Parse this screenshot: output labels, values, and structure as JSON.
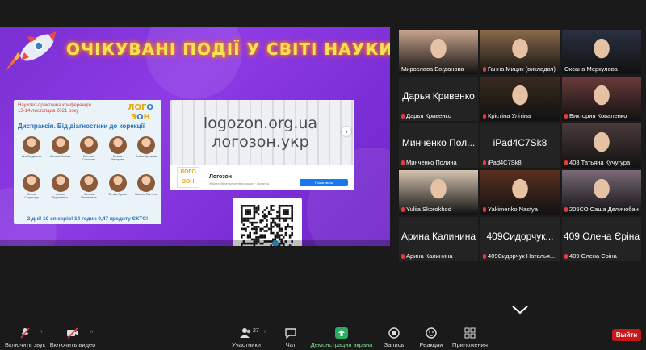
{
  "slide": {
    "title": "ОЧІКУВАНІ ПОДІЇ У СВІТІ НАУКИ",
    "conference": {
      "header_line1": "Науково-практична конференція",
      "header_line2": "13-14 листопада 2021 року",
      "logo": "ЛОГОЗОН",
      "subtitle": "Диспраксія. Від діагностики до корекції",
      "speakers_row1": [
        "Інна Богданова",
        "Наталія Бєлова",
        "Світлана Соколова",
        "Галина Макарова",
        "Любов Кроткова"
      ],
      "speakers_row2": [
        "Олена Скорохода",
        "Алена Бурлаченко",
        "Наталія Пантелєєва",
        "Тетяна Ярова",
        "Наталія Пантела"
      ],
      "footer": "2 дні! 10 спікерів! 14 годин 0,47 кредиту ЄКТС!"
    },
    "site": {
      "url_latin": "logozon.org.ua",
      "url_cyrillic": "логозон.укр",
      "page_name": "Логозон",
      "page_handle": "@speechtherapycenterlogozon · Логопед",
      "button_label": "Пошаговать",
      "avatar_text": "ЛОГО ЗОН"
    }
  },
  "participants": [
    {
      "caption": "Мирослава Богданова",
      "big": "",
      "muted": false,
      "type": "photo",
      "tone": "#c9a48e"
    },
    {
      "caption": "Ганна Мицик (викладач)",
      "big": "",
      "muted": true,
      "type": "photo",
      "tone": "#8a6a4a"
    },
    {
      "caption": "Оксана Меркулова",
      "big": "",
      "muted": false,
      "type": "photo",
      "tone": "#2a3040"
    },
    {
      "caption": "Дарья Кривенко",
      "big": "Дарья Кривенко",
      "muted": true,
      "type": "name"
    },
    {
      "caption": "Крістіна Улітіна",
      "big": "",
      "muted": true,
      "type": "photo",
      "tone": "#3a2a20",
      "active": true
    },
    {
      "caption": "Виктория Коваленко",
      "big": "",
      "muted": true,
      "type": "photo",
      "tone": "#6a3a3a"
    },
    {
      "caption": "Минченко Полина",
      "big": "Минченко Пол...",
      "muted": true,
      "type": "name"
    },
    {
      "caption": "iPad4C7Sk8",
      "big": "iPad4C7Sk8",
      "muted": true,
      "type": "name"
    },
    {
      "caption": "408 Татьяна Кучугура",
      "big": "",
      "muted": true,
      "type": "photo",
      "tone": "#4a3a3a"
    },
    {
      "caption": "Yuliia Skorokhod",
      "big": "",
      "muted": true,
      "type": "photo",
      "tone": "#d6c4b0"
    },
    {
      "caption": "Yakimenko Nastya",
      "big": "",
      "muted": true,
      "type": "photo",
      "tone": "#5a3020"
    },
    {
      "caption": "205СО Саша Деличобан",
      "big": "",
      "muted": true,
      "type": "photo",
      "tone": "#7a6a78"
    },
    {
      "caption": "Арина Калинина",
      "big": "Арина Калинина",
      "muted": true,
      "type": "name"
    },
    {
      "caption": "409Сидорчук Наталья...",
      "big": "409Сидорчук...",
      "muted": true,
      "type": "name"
    },
    {
      "caption": "409 Олена Єріна",
      "big": "409 Олена Єріна",
      "muted": true,
      "type": "name"
    }
  ],
  "toolbar": {
    "mute_label": "Включить звук",
    "video_label": "Включить видео",
    "participants_label": "Участники",
    "participants_count": "27",
    "chat_label": "Чат",
    "share_label": "Демонстрация экрана",
    "record_label": "Запись",
    "reactions_label": "Реакции",
    "apps_label": "Приложения",
    "leave_label": "Выйти"
  },
  "colors": {
    "slide_purple": "#8a36e0",
    "title_yellow": "#f2e35a",
    "leave_red": "#c8171b",
    "share_green": "#27ae60",
    "active_speaker": "#a8d65a"
  }
}
